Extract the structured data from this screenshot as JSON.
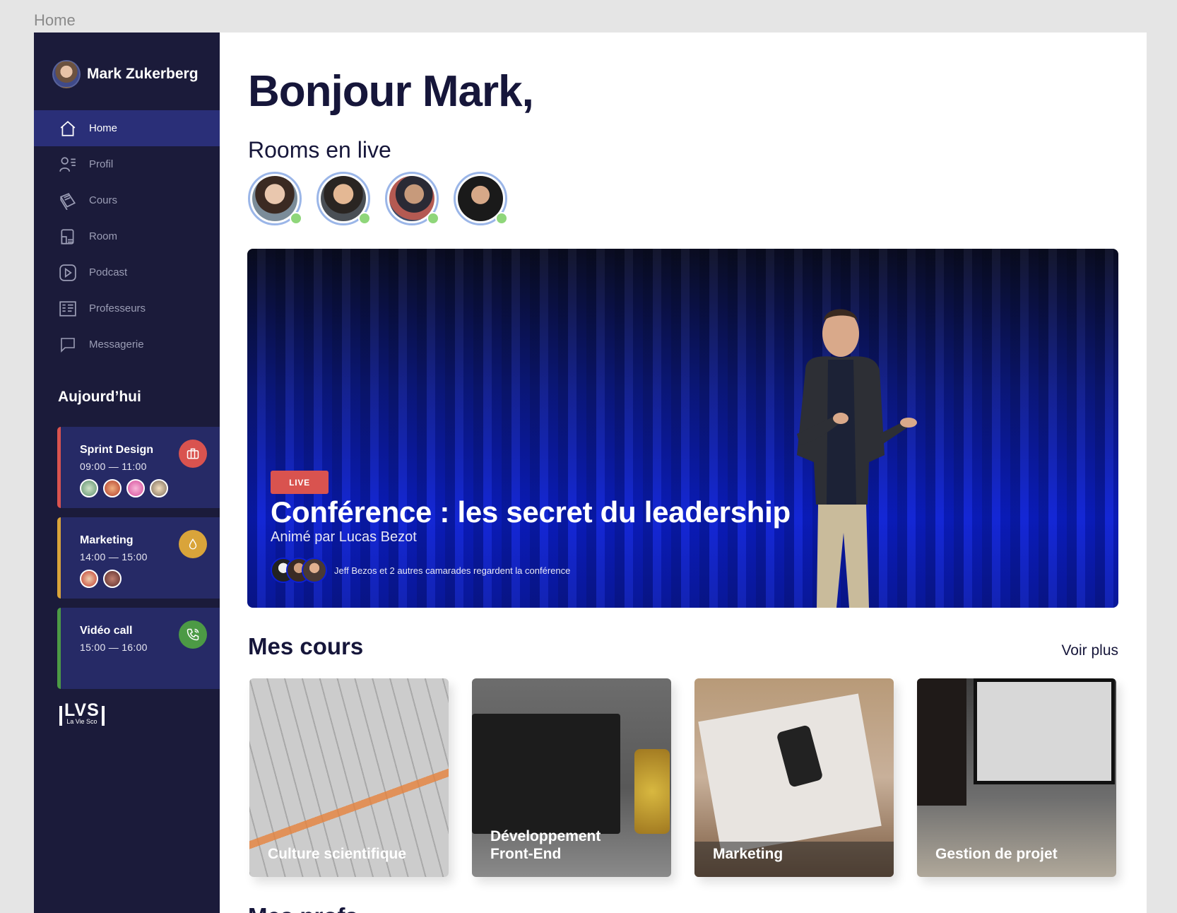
{
  "frame_label": "Home",
  "user": {
    "name": "Mark Zukerberg"
  },
  "nav": [
    {
      "label": "Home",
      "icon": "home-icon",
      "active": true
    },
    {
      "label": "Profil",
      "icon": "profile-icon"
    },
    {
      "label": "Cours",
      "icon": "book-icon"
    },
    {
      "label": "Room",
      "icon": "room-icon"
    },
    {
      "label": "Podcast",
      "icon": "play-icon"
    },
    {
      "label": "Professeurs",
      "icon": "teachers-icon"
    },
    {
      "label": "Messagerie",
      "icon": "message-icon"
    }
  ],
  "today": {
    "title": "Aujourd’hui",
    "events": [
      {
        "title": "Sprint Design",
        "time": "09:00  —  11:00",
        "color": "#d9534f",
        "icon": "briefcase-icon"
      },
      {
        "title": "Marketing",
        "time": "14:00  — 15:00",
        "color": "#d9a43a",
        "icon": "drop-icon"
      },
      {
        "title": "Vidéo call",
        "time": "15:00  —  16:00",
        "color": "#4c9a45",
        "icon": "phone-icon"
      }
    ]
  },
  "logo": {
    "main": "LVS",
    "sub": "La Vie Sco"
  },
  "main": {
    "greeting": "Bonjour Mark,",
    "rooms_title": "Rooms en live",
    "hero": {
      "tag": "LIVE",
      "title": "Conférence : les secret du leadership",
      "subtitle": "Animé par Lucas Bezot",
      "watchers_text": "Jeff Bezos et 2 autres camarades regardent la conférence"
    },
    "courses_title": "Mes cours",
    "see_more": "Voir plus",
    "courses": [
      {
        "label": "Culture scientifique"
      },
      {
        "label": "Développement Front-End"
      },
      {
        "label": "Marketing"
      },
      {
        "label": "Gestion de projet"
      }
    ],
    "next_title": "Mes profs"
  },
  "colors": {
    "sidebar": "#1b1b3a",
    "active": "#2a2f78",
    "live": "#d9534f",
    "online": "#8fd67a"
  }
}
